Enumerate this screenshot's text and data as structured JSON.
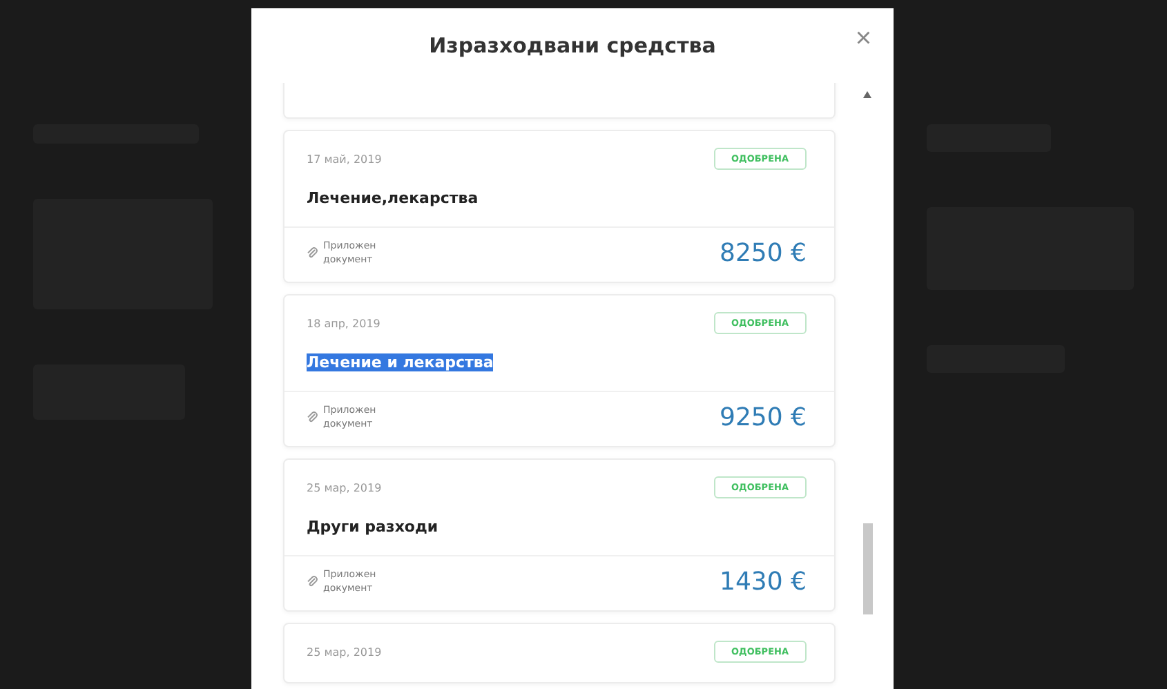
{
  "modal": {
    "title": "Изразходвани средства",
    "close": "×"
  },
  "expenses": [
    {
      "date": "17 май, 2019",
      "status": "ОДОБРЕНА",
      "title": "Лечение,лекарства",
      "highlighted": false,
      "attachment": "Приложен документ",
      "amount": "8250 €"
    },
    {
      "date": "18 апр, 2019",
      "status": "ОДОБРЕНА",
      "title": "Лечение и лекарства",
      "highlighted": true,
      "attachment": "Приложен документ",
      "amount": "9250 €"
    },
    {
      "date": "25 мар, 2019",
      "status": "ОДОБРЕНА",
      "title": "Други разходи",
      "highlighted": false,
      "attachment": "Приложен документ",
      "amount": "1430 €"
    },
    {
      "date": "25 мар, 2019",
      "status": "ОДОБРЕНА"
    }
  ]
}
